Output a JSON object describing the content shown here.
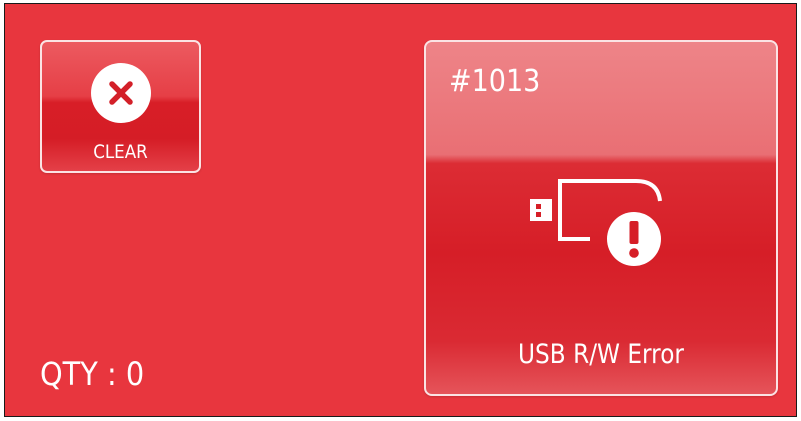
{
  "colors": {
    "background": "#e8363e",
    "button_dark": "#d51d26",
    "button_border": "#fbe3e4",
    "foreground": "#ffffff"
  },
  "clear_button": {
    "icon": "close-icon",
    "label": "CLEAR"
  },
  "alarm": {
    "code": "#1013",
    "icon": "usb-error-icon",
    "message": "USB R/W Error"
  },
  "quantity": {
    "text": "QTY : 0"
  }
}
